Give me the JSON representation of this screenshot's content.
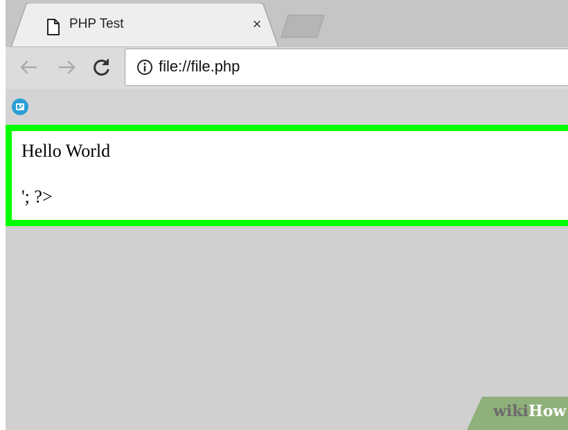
{
  "tabs": [
    {
      "title": "PHP Test",
      "close_glyph": "×",
      "active": true
    }
  ],
  "toolbar": {
    "back_icon": "arrow-left-icon",
    "forward_icon": "arrow-right-icon",
    "reload_icon": "reload-icon",
    "url": "file://file.php",
    "info_icon": "info-icon"
  },
  "bookmarks": {
    "icons": [
      "bookmark-app-icon"
    ]
  },
  "page": {
    "lines": [
      "Hello World",
      "'; ?>"
    ],
    "highlight_color": "#00ff00"
  },
  "watermark": {
    "part1": "wiki",
    "part2": "How",
    "bg_color": "#8fb07a"
  }
}
